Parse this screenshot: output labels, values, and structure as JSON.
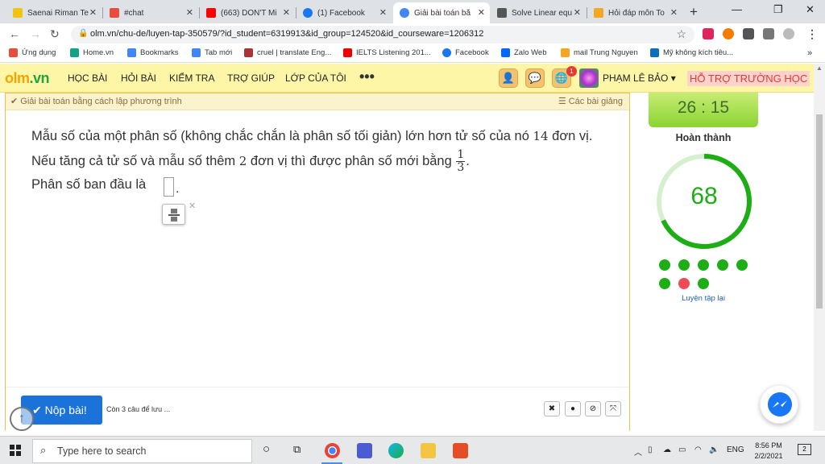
{
  "browser": {
    "tabs": [
      {
        "label": "Saenai Riman Te",
        "color": "#f1c40f",
        "active": false
      },
      {
        "label": "#chat",
        "color": "#e74c3c",
        "active": false
      },
      {
        "label": "(663) DON'T Mi",
        "color": "#ff0000",
        "active": false
      },
      {
        "label": "(1) Facebook",
        "color": "#1877f2",
        "active": false
      },
      {
        "label": "Giải bài toán bằ",
        "color": "#4285f4",
        "active": true
      },
      {
        "label": "Solve Linear equ",
        "color": "#555555",
        "active": false
      },
      {
        "label": "Hỏi đáp môn To",
        "color": "#f5a623",
        "active": false
      }
    ],
    "url": "olm.vn/chu-de/luyen-tap-350579/?id_student=6319913&id_group=124520&id_courseware=1206312",
    "bookmarks": [
      {
        "label": "Ứng dụng",
        "color": "#e74c3c"
      },
      {
        "label": "Home.vn",
        "color": "#16a085"
      },
      {
        "label": "Bookmarks",
        "color": "#4285f4"
      },
      {
        "label": "Tab mới",
        "color": "#4285f4"
      },
      {
        "label": "cruel | translate Eng...",
        "color": "#a33"
      },
      {
        "label": "IELTS Listening 201...",
        "color": "#e00"
      },
      {
        "label": "Facebook",
        "color": "#1877f2"
      },
      {
        "label": "Zalo Web",
        "color": "#0068ff"
      },
      {
        "label": "mail Trung Nguyen",
        "color": "#f5a623"
      },
      {
        "label": "Mỹ không kích tiêu...",
        "color": "#0a6ebd"
      }
    ]
  },
  "site": {
    "logo_main": "olm",
    "logo_dot": ".vn",
    "menu": [
      "HỌC BÀI",
      "HỎI BÀI",
      "KIỂM TRA",
      "TRỢ GIÚP",
      "LỚP CỦA TÔI"
    ],
    "more": "•••",
    "notification_count": "1",
    "username": "PHẠM LÊ BẢO ▾",
    "support": "HỖ TRỢ TRƯỜNG HỌC"
  },
  "card": {
    "header_left": "✔ Giải bài toán bằng cách lập phương trình",
    "header_right": "☰ Các bài giảng",
    "question_p1": "Mẫu số của một phân số (không chắc chắn là phân số tối giản) lớn hơn tử số của nó ",
    "question_num1": "14",
    "question_p2": " đơn vị. Nếu tăng cả tử số và mẫu số thêm ",
    "question_num2": "2",
    "question_p3": " đơn vị thì được phân số mới bằng ",
    "frac_num": "1",
    "frac_den": "3",
    "question_end": ".",
    "answer_label": "Phân số ban đầu là",
    "answer_end": ".",
    "submit": "✔ Nộp bài!",
    "unsaved": "Còn 3 câu để lưu ..."
  },
  "side": {
    "timer": "26 : 15",
    "done_label": "Hoàn thành",
    "progress_value": "68",
    "progress_percent": 68,
    "results": [
      "correct",
      "correct",
      "correct",
      "correct",
      "correct",
      "correct",
      "wrong",
      "correct"
    ],
    "correct_color": "#1dad14",
    "wrong_color": "#ef4b56",
    "retry": "Luyện tập lại"
  },
  "taskbar": {
    "search_placeholder": "Type here to search",
    "lang": "ENG",
    "time": "8:56 PM",
    "date": "2/2/2021",
    "notifications": "2"
  }
}
